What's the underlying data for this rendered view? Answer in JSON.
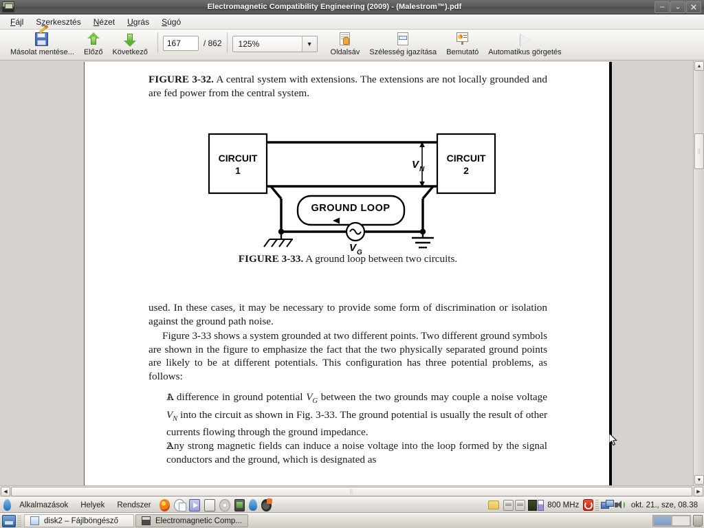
{
  "window": {
    "title": "Electromagnetic Compatibility Engineering (2009) - (Malestrom™).pdf",
    "icon": "application-icon",
    "minimize": "–",
    "maximize": "⌄",
    "close": "✕"
  },
  "menubar": {
    "items": [
      {
        "label": "Fájl",
        "accel": "F"
      },
      {
        "label": "Szerkesztés",
        "accel": "z"
      },
      {
        "label": "Nézet",
        "accel": "N"
      },
      {
        "label": "Ugrás",
        "accel": "U"
      },
      {
        "label": "Súgó",
        "accel": "S"
      }
    ]
  },
  "toolbar": {
    "save_copy_label": "Másolat mentése...",
    "previous_label": "Előző",
    "next_label": "Következő",
    "page_current": "167",
    "page_total": "/ 862",
    "zoom_value": "125%",
    "zoom_arrow": "▼",
    "sidebar_label": "Oldalsáv",
    "fit_width_label": "Szélesség igazítása",
    "presentation_label": "Bemutató",
    "autoscroll_label": "Automatikus görgetés"
  },
  "document": {
    "fig32_label": "FIGURE 3-32.",
    "fig32_caption": " A central system with extensions. The extensions are not locally grounded and are fed power from the central system.",
    "figure": {
      "circuit1_line1": "CIRCUIT",
      "circuit1_line2": "1",
      "circuit2_line1": "CIRCUIT",
      "circuit2_line2": "2",
      "ground_loop_label": "GROUND LOOP",
      "vn_label": "V",
      "vn_sub": "N",
      "vg_label": "V",
      "vg_sub": "G"
    },
    "fig33_label": "FIGURE 3-33.",
    "fig33_caption": " A ground loop between two circuits.",
    "para1": "used. In these cases, it may be necessary to provide some form of discrimination or isolation against the ground path noise.",
    "para2": "Figure 3-33 shows a system grounded at two different points. Two different ground symbols are shown in the figure to emphasize the fact that the two physically separated ground points are likely to be at different potentials. This configuration has three potential problems, as follows:",
    "list": [
      {
        "num": "1.",
        "part1": "A difference in ground potential ",
        "var1": "V",
        "sub1": "G",
        "part2": " between the two grounds may couple a noise voltage ",
        "var2": "V",
        "sub2": "N",
        "part3": " into the circuit as shown in Fig. 3-33. The ground potential is usually the result of other currents flowing through the ground impedance."
      },
      {
        "num": "2.",
        "part1": "Any strong magnetic fields can induce a noise voltage into the loop formed by the signal conductors and the ground, which is designated as",
        "var1": "",
        "sub1": "",
        "part2": "",
        "var2": "",
        "sub2": "",
        "part3": ""
      }
    ]
  },
  "scrollbars": {
    "v_up": "▲",
    "v_down": "▼",
    "v_thumb_grip": "⣿",
    "h_left": "◀",
    "h_right": "▶",
    "h_thumb_grip": "⣿"
  },
  "panel": {
    "menus": [
      "Alkalmazások",
      "Helyek",
      "Rendszer"
    ],
    "launchers": [
      "firefox-icon",
      "notes-icon",
      "gimp-icon",
      "calculator-icon",
      "disc-icon",
      "system-monitor-icon",
      "water-drop-icon"
    ],
    "tray": {
      "music_icon": "amarok-icon",
      "folder_icon": "folder-icon",
      "network1_icon": "network-icon",
      "network2_icon": "network-icon",
      "cpu_icon": "cpu-frequency-icon",
      "cpu_freq": "800 MHz",
      "power_icon": "shutdown-icon",
      "netmon_icon": "network-monitor-icon",
      "volume_icon": "volume-icon",
      "clock": "okt. 21., sze, 08.38"
    }
  },
  "winbar": {
    "show_desktop": "show-desktop-icon",
    "tasks": [
      {
        "label": "disk2 – Fájlböngésző",
        "icon": "file-manager-icon",
        "active": false
      },
      {
        "label": "Electromagnetic Comp...",
        "icon": "pdf-icon",
        "active": true
      }
    ],
    "trash": "trash-icon"
  },
  "colors": {
    "titlebar": "#5a5a5a",
    "toolbar": "#eeece8",
    "desk": "#d6d3ce",
    "page": "#ffffff",
    "accent_green": "#63b43a"
  }
}
